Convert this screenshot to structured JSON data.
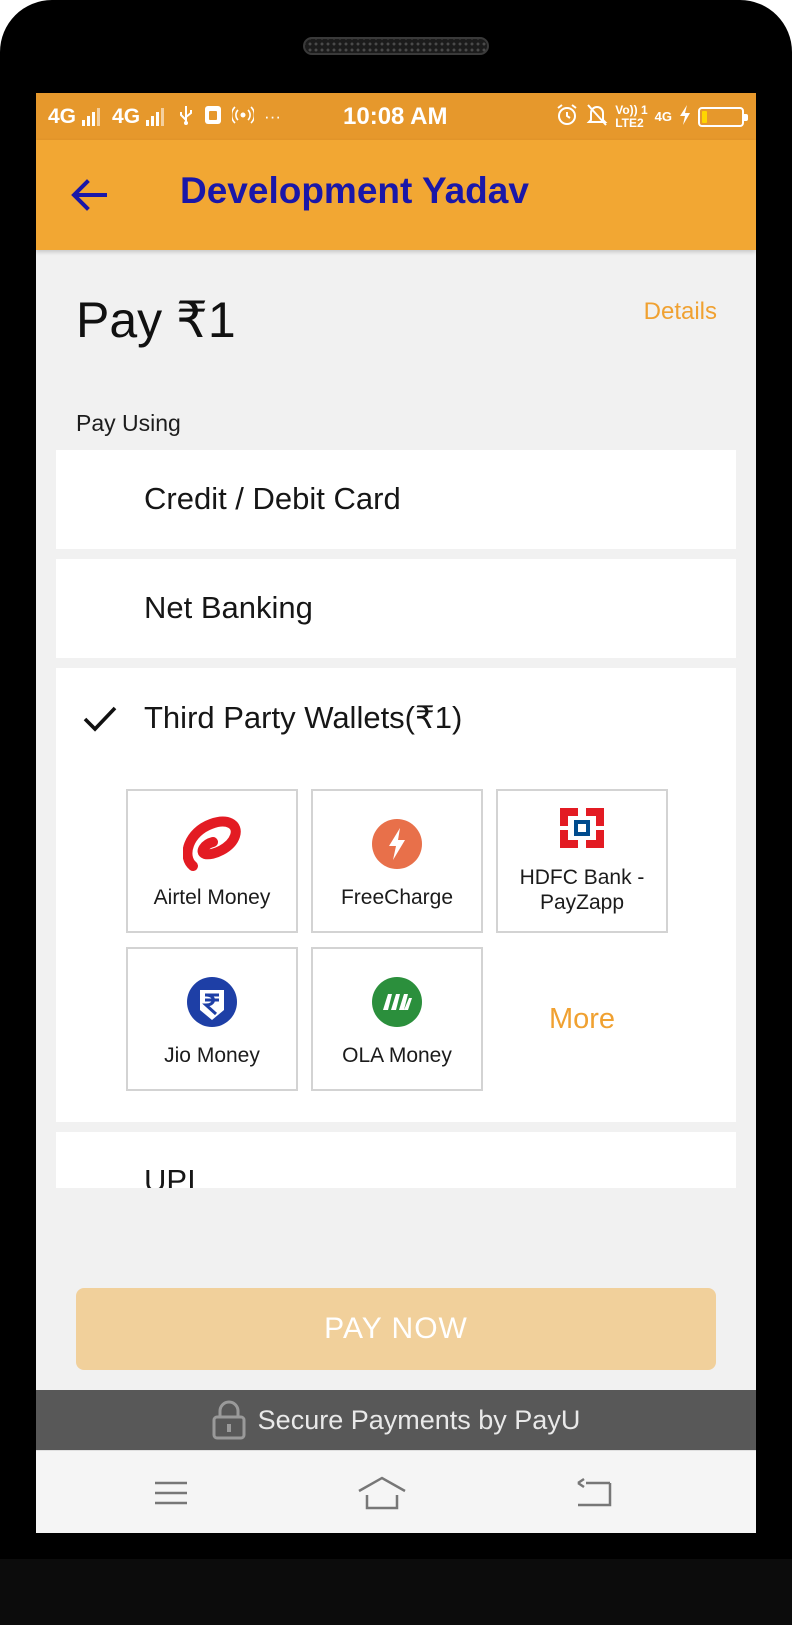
{
  "status_bar": {
    "network1": "4G",
    "network2": "4G",
    "time": "10:08 AM",
    "more_icon": "···",
    "volte_top": "Vo)) 1",
    "volte_bottom": "LTE2",
    "net_right": "4G",
    "battery_level": 0.12
  },
  "app_bar": {
    "title": "Development Yadav"
  },
  "summary": {
    "pay_label": "Pay ₹1",
    "details_label": "Details"
  },
  "pay_using_label": "Pay Using",
  "payment_options": {
    "card": "Credit / Debit Card",
    "netbanking": "Net Banking",
    "wallets": "Third Party Wallets(₹1)",
    "upi": "UPI"
  },
  "wallets": [
    {
      "name": "Airtel Money",
      "icon": "airtel-logo"
    },
    {
      "name": "FreeCharge",
      "icon": "freecharge-logo"
    },
    {
      "name_line1": "HDFC Bank -",
      "name_line2": "PayZapp",
      "icon": "hdfc-logo"
    },
    {
      "name": "Jio Money",
      "icon": "jio-money-logo"
    },
    {
      "name": "OLA Money",
      "icon": "ola-money-logo"
    }
  ],
  "more_label": "More",
  "pay_now_label": "PAY NOW",
  "secure_label": "Secure Payments by PayU",
  "colors": {
    "status_bar": "#e6982c",
    "app_bar": "#f2a733",
    "title": "#1a17a8",
    "accent": "#f0a131",
    "pay_button": "#f1d09b",
    "footer": "#585858"
  }
}
